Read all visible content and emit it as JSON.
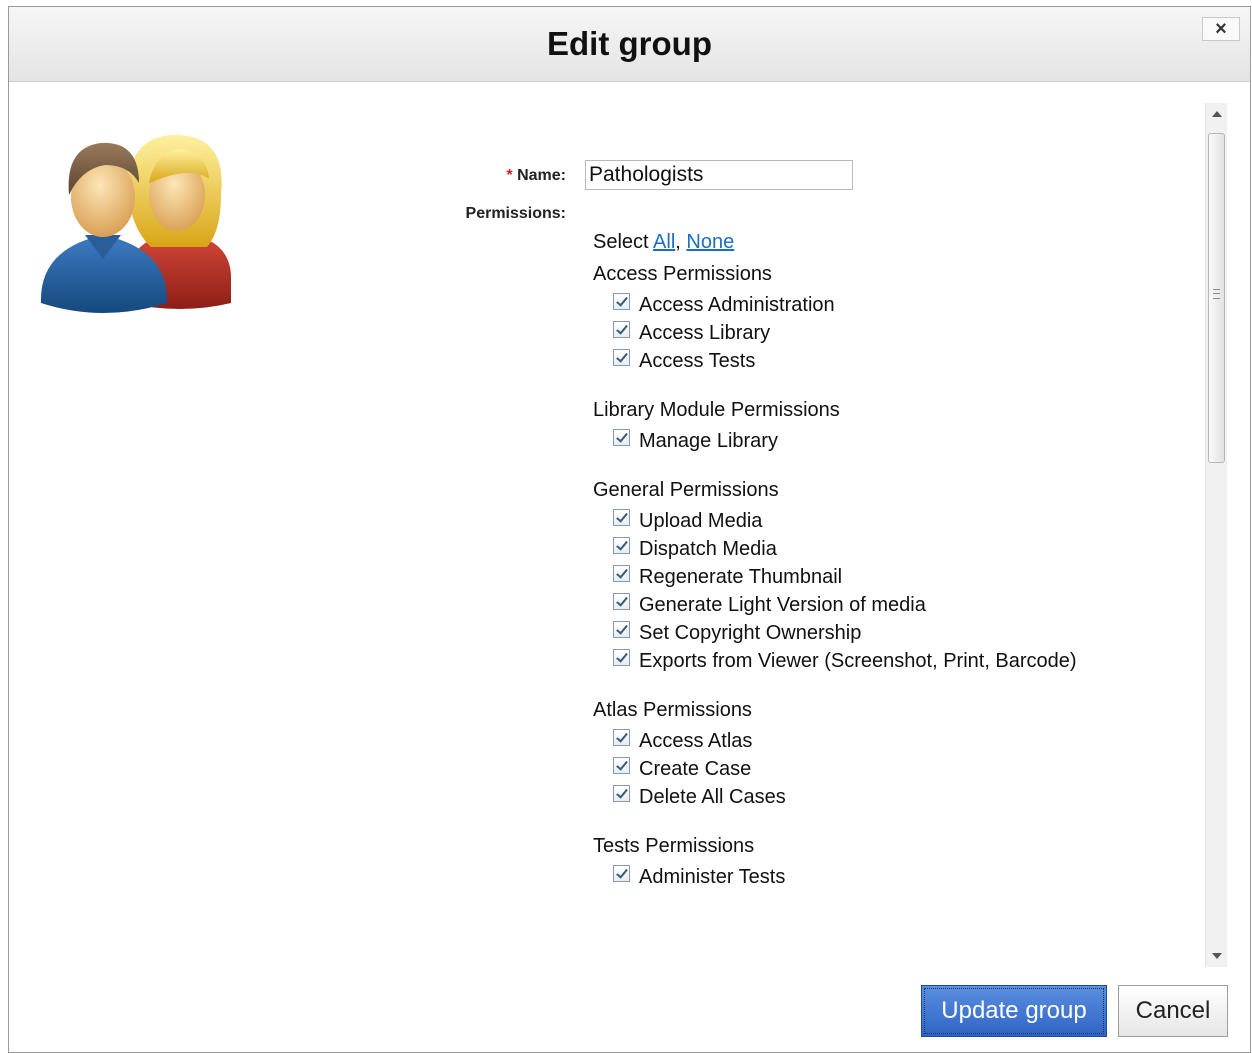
{
  "dialog": {
    "title": "Edit group",
    "close_label": "×"
  },
  "form": {
    "name_required_marker": "*",
    "name_label": "Name:",
    "name_value": "Pathologists",
    "permissions_label": "Permissions:",
    "select_prefix": "Select",
    "select_all": "All",
    "select_separator": ",",
    "select_none": "None"
  },
  "permission_groups": [
    {
      "title": "Access Permissions",
      "items": [
        {
          "label": "Access Administration",
          "checked": true
        },
        {
          "label": "Access Library",
          "checked": true
        },
        {
          "label": "Access Tests",
          "checked": true
        }
      ]
    },
    {
      "title": "Library Module Permissions",
      "items": [
        {
          "label": "Manage Library",
          "checked": true
        }
      ]
    },
    {
      "title": "General Permissions",
      "items": [
        {
          "label": "Upload Media",
          "checked": true
        },
        {
          "label": "Dispatch Media",
          "checked": true
        },
        {
          "label": "Regenerate Thumbnail",
          "checked": true
        },
        {
          "label": "Generate Light Version of media",
          "checked": true
        },
        {
          "label": "Set Copyright Ownership",
          "checked": true
        },
        {
          "label": "Exports from Viewer (Screenshot, Print, Barcode)",
          "checked": true
        }
      ]
    },
    {
      "title": "Atlas Permissions",
      "items": [
        {
          "label": "Access Atlas",
          "checked": true
        },
        {
          "label": "Create Case",
          "checked": true
        },
        {
          "label": "Delete All Cases",
          "checked": true
        }
      ]
    },
    {
      "title": "Tests Permissions",
      "items": [
        {
          "label": "Administer Tests",
          "checked": true
        }
      ]
    }
  ],
  "buttons": {
    "update": "Update group",
    "cancel": "Cancel"
  },
  "colors": {
    "primary_button": "#2f64c6",
    "link": "#1a6fc4",
    "required": "#cc2222"
  }
}
